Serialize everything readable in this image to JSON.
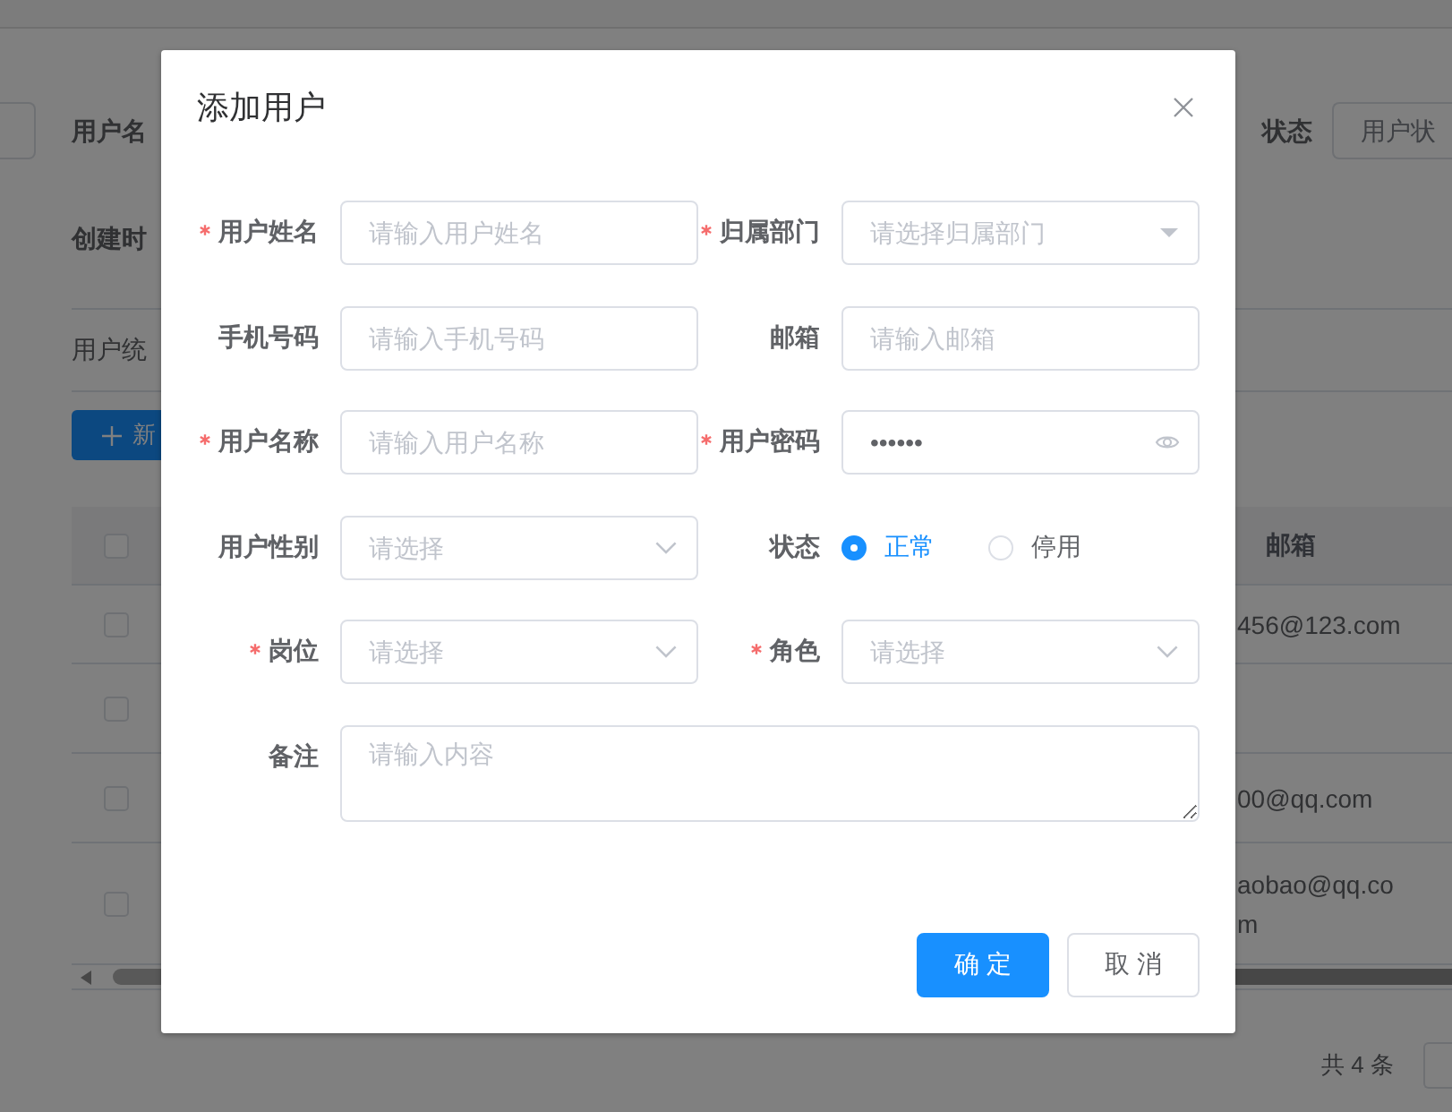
{
  "background": {
    "search_form": {
      "labels": [
        "用户名",
        "创建时"
      ]
    },
    "status_filter": {
      "label": "状态",
      "placeholder": "用户状"
    },
    "section_title": "用户统",
    "add_button": {
      "label": "新"
    },
    "table": {
      "header": {
        "checked": false,
        "column": "邮箱"
      },
      "rows": [
        {
          "checked": false,
          "email": "456@123.com"
        },
        {
          "checked": false
        },
        {
          "checked": false,
          "email": "00@qq.com"
        },
        {
          "checked": false,
          "email": "aobao@qq.co\nm"
        }
      ]
    },
    "pagination": {
      "total": "共 4 条"
    }
  },
  "dialog": {
    "title": "添加用户",
    "fields": [
      {
        "kind": "input",
        "label": "用户姓名",
        "required": true,
        "placeholder": "请输入用户姓名"
      },
      {
        "kind": "tree-select",
        "label": "归属部门",
        "required": true,
        "placeholder": "请选择归属部门"
      },
      {
        "kind": "input",
        "label": "手机号码",
        "required": false,
        "placeholder": "请输入手机号码"
      },
      {
        "kind": "input",
        "label": "邮箱",
        "required": false,
        "placeholder": "请输入邮箱"
      },
      {
        "kind": "input",
        "label": "用户名称",
        "required": true,
        "placeholder": "请输入用户名称"
      },
      {
        "kind": "password",
        "label": "用户密码",
        "required": true,
        "value": "••••••"
      },
      {
        "kind": "select",
        "label": "用户性别",
        "required": false,
        "placeholder": "请选择"
      },
      {
        "kind": "radio",
        "label": "状态",
        "required": false,
        "options": [
          {
            "label": "正常",
            "selected": true
          },
          {
            "label": "停用",
            "selected": false
          }
        ]
      },
      {
        "kind": "select",
        "label": "岗位",
        "required": true,
        "placeholder": "请选择"
      },
      {
        "kind": "select",
        "label": "角色",
        "required": true,
        "placeholder": "请选择"
      },
      {
        "kind": "textarea",
        "label": "备注",
        "required": false,
        "placeholder": "请输入内容"
      }
    ],
    "buttons": [
      {
        "label": "确 定",
        "kind": "primary"
      },
      {
        "label": "取 消",
        "kind": "default"
      }
    ]
  }
}
